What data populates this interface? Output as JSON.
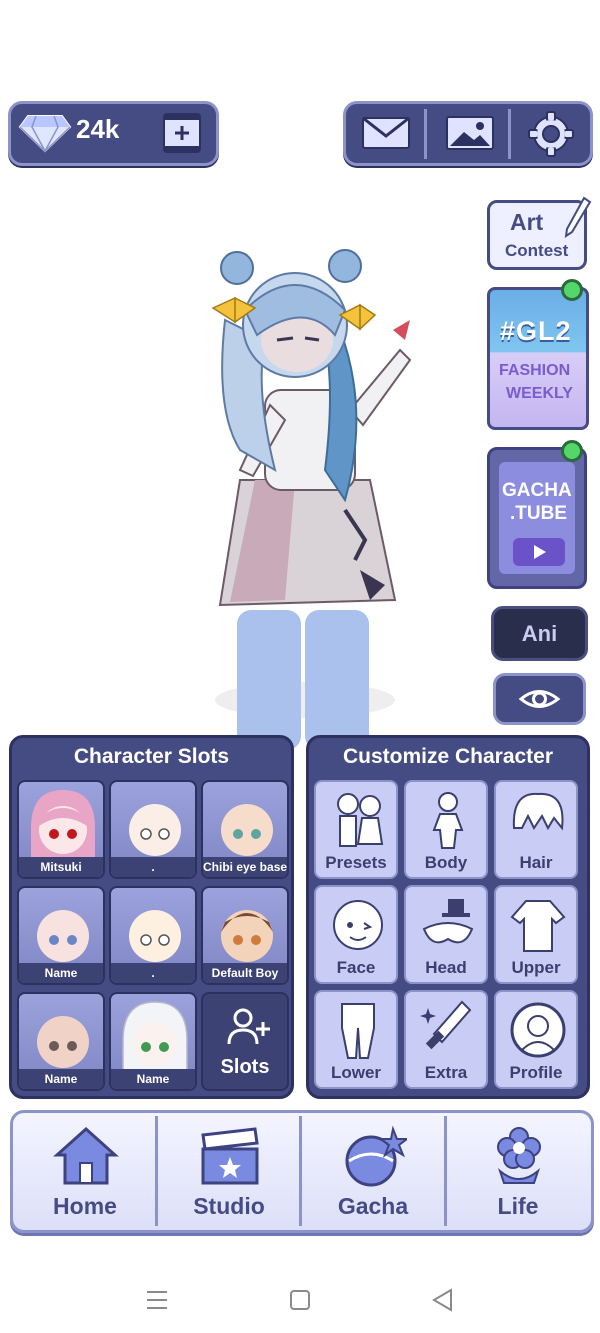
{
  "header": {
    "gem_count": "24k"
  },
  "side": {
    "art_contest_line1": "Art",
    "art_contest_line2": "Contest",
    "gl2_tag": "#GL2",
    "gl2_sub1": "FASHION",
    "gl2_sub2": "WEEKLY",
    "gacha_tube_line1": "GACHA",
    "gacha_tube_line2": ".TUBE",
    "ani_label": "Ani"
  },
  "slots_panel": {
    "title": "Character Slots",
    "slots": [
      {
        "name": "Mitsuki"
      },
      {
        "name": "."
      },
      {
        "name": "Chibi eye base"
      },
      {
        "name": "Name"
      },
      {
        "name": "."
      },
      {
        "name": "Default Boy"
      },
      {
        "name": "Name"
      },
      {
        "name": "Name"
      }
    ],
    "add_label": "Slots"
  },
  "customize_panel": {
    "title": "Customize Character",
    "categories": [
      {
        "label": "Presets"
      },
      {
        "label": "Body"
      },
      {
        "label": "Hair"
      },
      {
        "label": "Face"
      },
      {
        "label": "Head"
      },
      {
        "label": "Upper"
      },
      {
        "label": "Lower"
      },
      {
        "label": "Extra"
      },
      {
        "label": "Profile"
      }
    ]
  },
  "nav": {
    "items": [
      {
        "label": "Home"
      },
      {
        "label": "Studio"
      },
      {
        "label": "Gacha"
      },
      {
        "label": "Life"
      }
    ]
  },
  "colors": {
    "panel": "#454b83",
    "panel_border": "#2c3160",
    "tile": "#c9cdf5",
    "notification": "#53d66a"
  }
}
